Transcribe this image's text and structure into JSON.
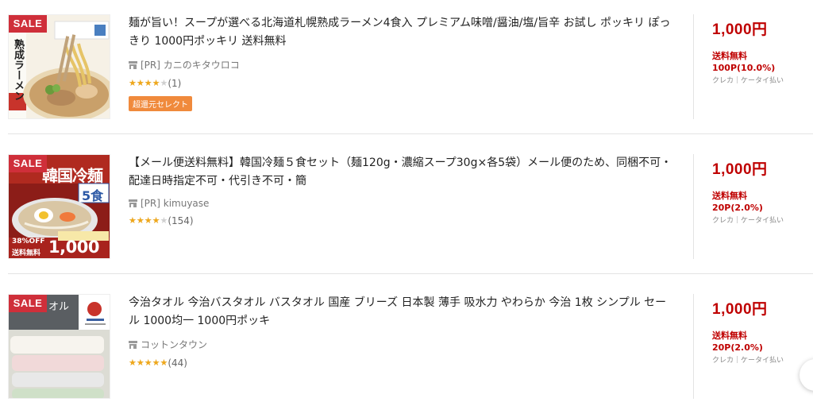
{
  "items": [
    {
      "sale_label": "SALE",
      "title": "麺が旨い！スープが選べる北海道札幌熟成ラーメン4食入 プレミアム味噌/醤油/塩/旨辛 お試し ポッキリ ぽっきり 1000円ポッキリ 送料無料",
      "shop": "[PR] カニのキタウロコ",
      "rating": 4,
      "review_count": "(1)",
      "tag": "超還元セレクト",
      "price": "1,000円",
      "shipping": "送料無料",
      "points": "100P(10.0%)",
      "payment": "クレカ｜ケータイ払い",
      "image_text": "熟成ラーメン"
    },
    {
      "sale_label": "SALE",
      "title": "【メール便送料無料】韓国冷麺５食セット（麺120g・濃縮スープ30g×各5袋）メール便のため、同梱不可・配達日時指定不可・代引き不可・簡",
      "shop": "[PR] kimuyase",
      "rating": 4,
      "review_count": "(154)",
      "price": "1,000円",
      "shipping": "送料無料",
      "points": "20P(2.0%)",
      "payment": "クレカ｜ケータイ払い",
      "image_text": "韓国冷麺",
      "image_badge": "5食",
      "image_price": "1,000円",
      "image_off": "38%OFF",
      "image_free": "送料無料"
    },
    {
      "sale_label": "SALE",
      "title": "今治タオル 今治バスタオル バスタオル 国産 ブリーズ 日本製 薄手 吸水力 やわらか 今治 1枚 シンプル セール 1000均一 1000円ポッキ",
      "shop": "コットンタウン",
      "rating": 5,
      "review_count": "(44)",
      "price": "1,000円",
      "shipping": "送料無料",
      "points": "20P(2.0%)",
      "payment": "クレカ｜ケータイ払い",
      "image_text": "オル"
    }
  ],
  "stars_glyph": "★★★★★",
  "colors": {
    "price": "#bf0000",
    "sale": "#cf2f3a",
    "star": "#f0a81a",
    "tag": "#f08a3c"
  }
}
